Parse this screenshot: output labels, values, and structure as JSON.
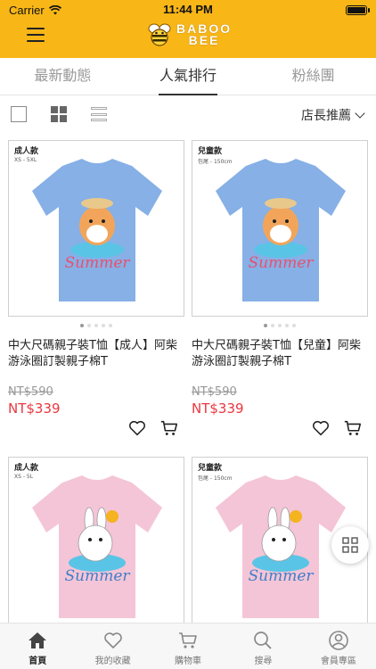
{
  "status_bar": {
    "carrier": "Carrier",
    "time": "11:44 PM"
  },
  "header": {
    "logo_line1": "BABOO",
    "logo_line2": "BEE"
  },
  "tabs": [
    {
      "label": "最新動態",
      "active": false
    },
    {
      "label": "人氣排行",
      "active": true
    },
    {
      "label": "粉絲團",
      "active": false
    }
  ],
  "toolbar": {
    "sort_label": "店長推薦"
  },
  "products": [
    {
      "badge": "成人款",
      "size_note": "XS - 5XL",
      "shirt_color": "#86b0e6",
      "title": "中大尺碼親子裝T恤【成人】阿柴游泳圈訂製親子棉T",
      "old_price": "NT$590",
      "price": "NT$339",
      "animal": "shiba"
    },
    {
      "badge": "兒童款",
      "size_note": "包尾 - 150cm",
      "shirt_color": "#86b0e6",
      "title": "中大尺碼親子裝T恤【兒童】阿柴游泳圈訂製親子棉T",
      "old_price": "NT$590",
      "price": "NT$339",
      "animal": "shiba"
    },
    {
      "badge": "成人款",
      "size_note": "XS - 5L",
      "shirt_color": "#f4c5d6",
      "animal": "bunny"
    },
    {
      "badge": "兒童款",
      "size_note": "包尾 - 150cm",
      "shirt_color": "#f4c5d6",
      "animal": "bunny"
    }
  ],
  "shirt_print_text": "Summer",
  "bottom_nav": [
    {
      "label": "首頁",
      "icon": "home-icon",
      "active": true
    },
    {
      "label": "我的收藏",
      "icon": "heart-icon",
      "active": false
    },
    {
      "label": "購物車",
      "icon": "cart-icon",
      "active": false
    },
    {
      "label": "搜尋",
      "icon": "search-icon",
      "active": false
    },
    {
      "label": "會員專區",
      "icon": "user-icon",
      "active": false
    }
  ],
  "colors": {
    "brand_yellow": "#f8b617",
    "price_red": "#e9373f"
  }
}
